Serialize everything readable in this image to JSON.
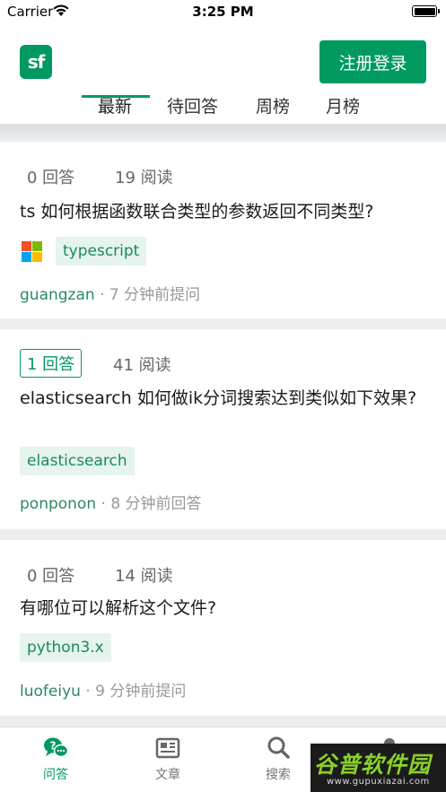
{
  "status_bar": {
    "carrier": "Carrier",
    "time": "3:25 PM"
  },
  "header": {
    "logo_text": "sf",
    "login_label": "注册登录",
    "tabs": [
      {
        "label": "最新",
        "active": true
      },
      {
        "label": "待回答"
      },
      {
        "label": "周榜"
      },
      {
        "label": "月榜"
      }
    ]
  },
  "accent_color": "#009a61",
  "questions": [
    {
      "answers": "0 回答",
      "views": "19 阅读",
      "title": "ts 如何根据函数联合类型的参数返回不同类型?",
      "tag_icon": "microsoft-icon",
      "tags": [
        "typescript"
      ],
      "author": "guangzan",
      "time": "· 7 分钟前提问"
    },
    {
      "answers": "1 回答",
      "answered": true,
      "views": "41 阅读",
      "title": "elasticsearch 如何做ik分词搜索达到类似如下效果?",
      "tags": [
        "elasticsearch"
      ],
      "author": "ponponon",
      "time": "· 8 分钟前回答"
    },
    {
      "answers": "0 回答",
      "views": "14 阅读",
      "title": "有哪位可以解析这个文件?",
      "tags": [
        "python3.x"
      ],
      "author": "luofeiyu",
      "time": "· 9 分钟前提问"
    }
  ],
  "bottom_nav": [
    {
      "label": "问答",
      "icon": "qa-icon",
      "active": true
    },
    {
      "label": "文章",
      "icon": "article-icon"
    },
    {
      "label": "搜索",
      "icon": "search-icon"
    },
    {
      "label": "",
      "icon": "user-icon"
    }
  ],
  "watermark": {
    "text": "谷普软件园",
    "url": "www.gupuxiazai.com"
  }
}
